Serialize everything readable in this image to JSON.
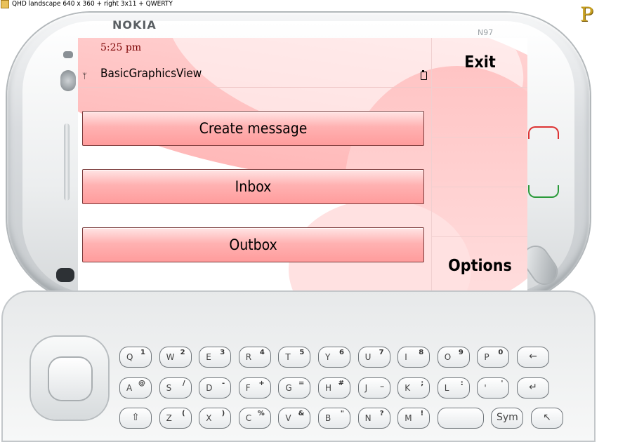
{
  "simulator": {
    "title": "QHD landscape 640 x 360 + right 3x11 + QWERTY"
  },
  "device": {
    "brand": "NOKIA",
    "model": "N97"
  },
  "status": {
    "time": "5:25 pm",
    "app_title": "BasicGraphicsView"
  },
  "menu": [
    {
      "label": "Create message"
    },
    {
      "label": "Inbox"
    },
    {
      "label": "Outbox"
    }
  ],
  "softkeys": {
    "exit": "Exit",
    "options": "Options"
  },
  "keyboard": {
    "row1": [
      {
        "k": "Q",
        "a": "1"
      },
      {
        "k": "W",
        "a": "2"
      },
      {
        "k": "E",
        "a": "3"
      },
      {
        "k": "R",
        "a": "4"
      },
      {
        "k": "T",
        "a": "5"
      },
      {
        "k": "Y",
        "a": "6"
      },
      {
        "k": "U",
        "a": "7"
      },
      {
        "k": "I",
        "a": "8"
      },
      {
        "k": "O",
        "a": "9"
      },
      {
        "k": "P",
        "a": "0"
      },
      {
        "k": "←",
        "a": ""
      }
    ],
    "row2": [
      {
        "k": "A",
        "a": "@"
      },
      {
        "k": "S",
        "a": "/"
      },
      {
        "k": "D",
        "a": "-"
      },
      {
        "k": "F",
        "a": "+"
      },
      {
        "k": "G",
        "a": "="
      },
      {
        "k": "H",
        "a": "#"
      },
      {
        "k": "J",
        "a": "_"
      },
      {
        "k": "K",
        "a": ";"
      },
      {
        "k": "L",
        "a": ":"
      },
      {
        "k": "'",
        "a": "'"
      },
      {
        "k": "↵",
        "a": ""
      }
    ],
    "row3": [
      {
        "k": "⇧",
        "a": ""
      },
      {
        "k": "Z",
        "a": "("
      },
      {
        "k": "X",
        "a": ")"
      },
      {
        "k": "C",
        "a": "%"
      },
      {
        "k": "V",
        "a": "&"
      },
      {
        "k": "B",
        "a": "\""
      },
      {
        "k": "N",
        "a": "?"
      },
      {
        "k": "M",
        "a": "!"
      },
      {
        "k": "",
        "a": ""
      },
      {
        "k": "Sym",
        "a": ""
      },
      {
        "k": "↖",
        "a": ""
      }
    ]
  }
}
